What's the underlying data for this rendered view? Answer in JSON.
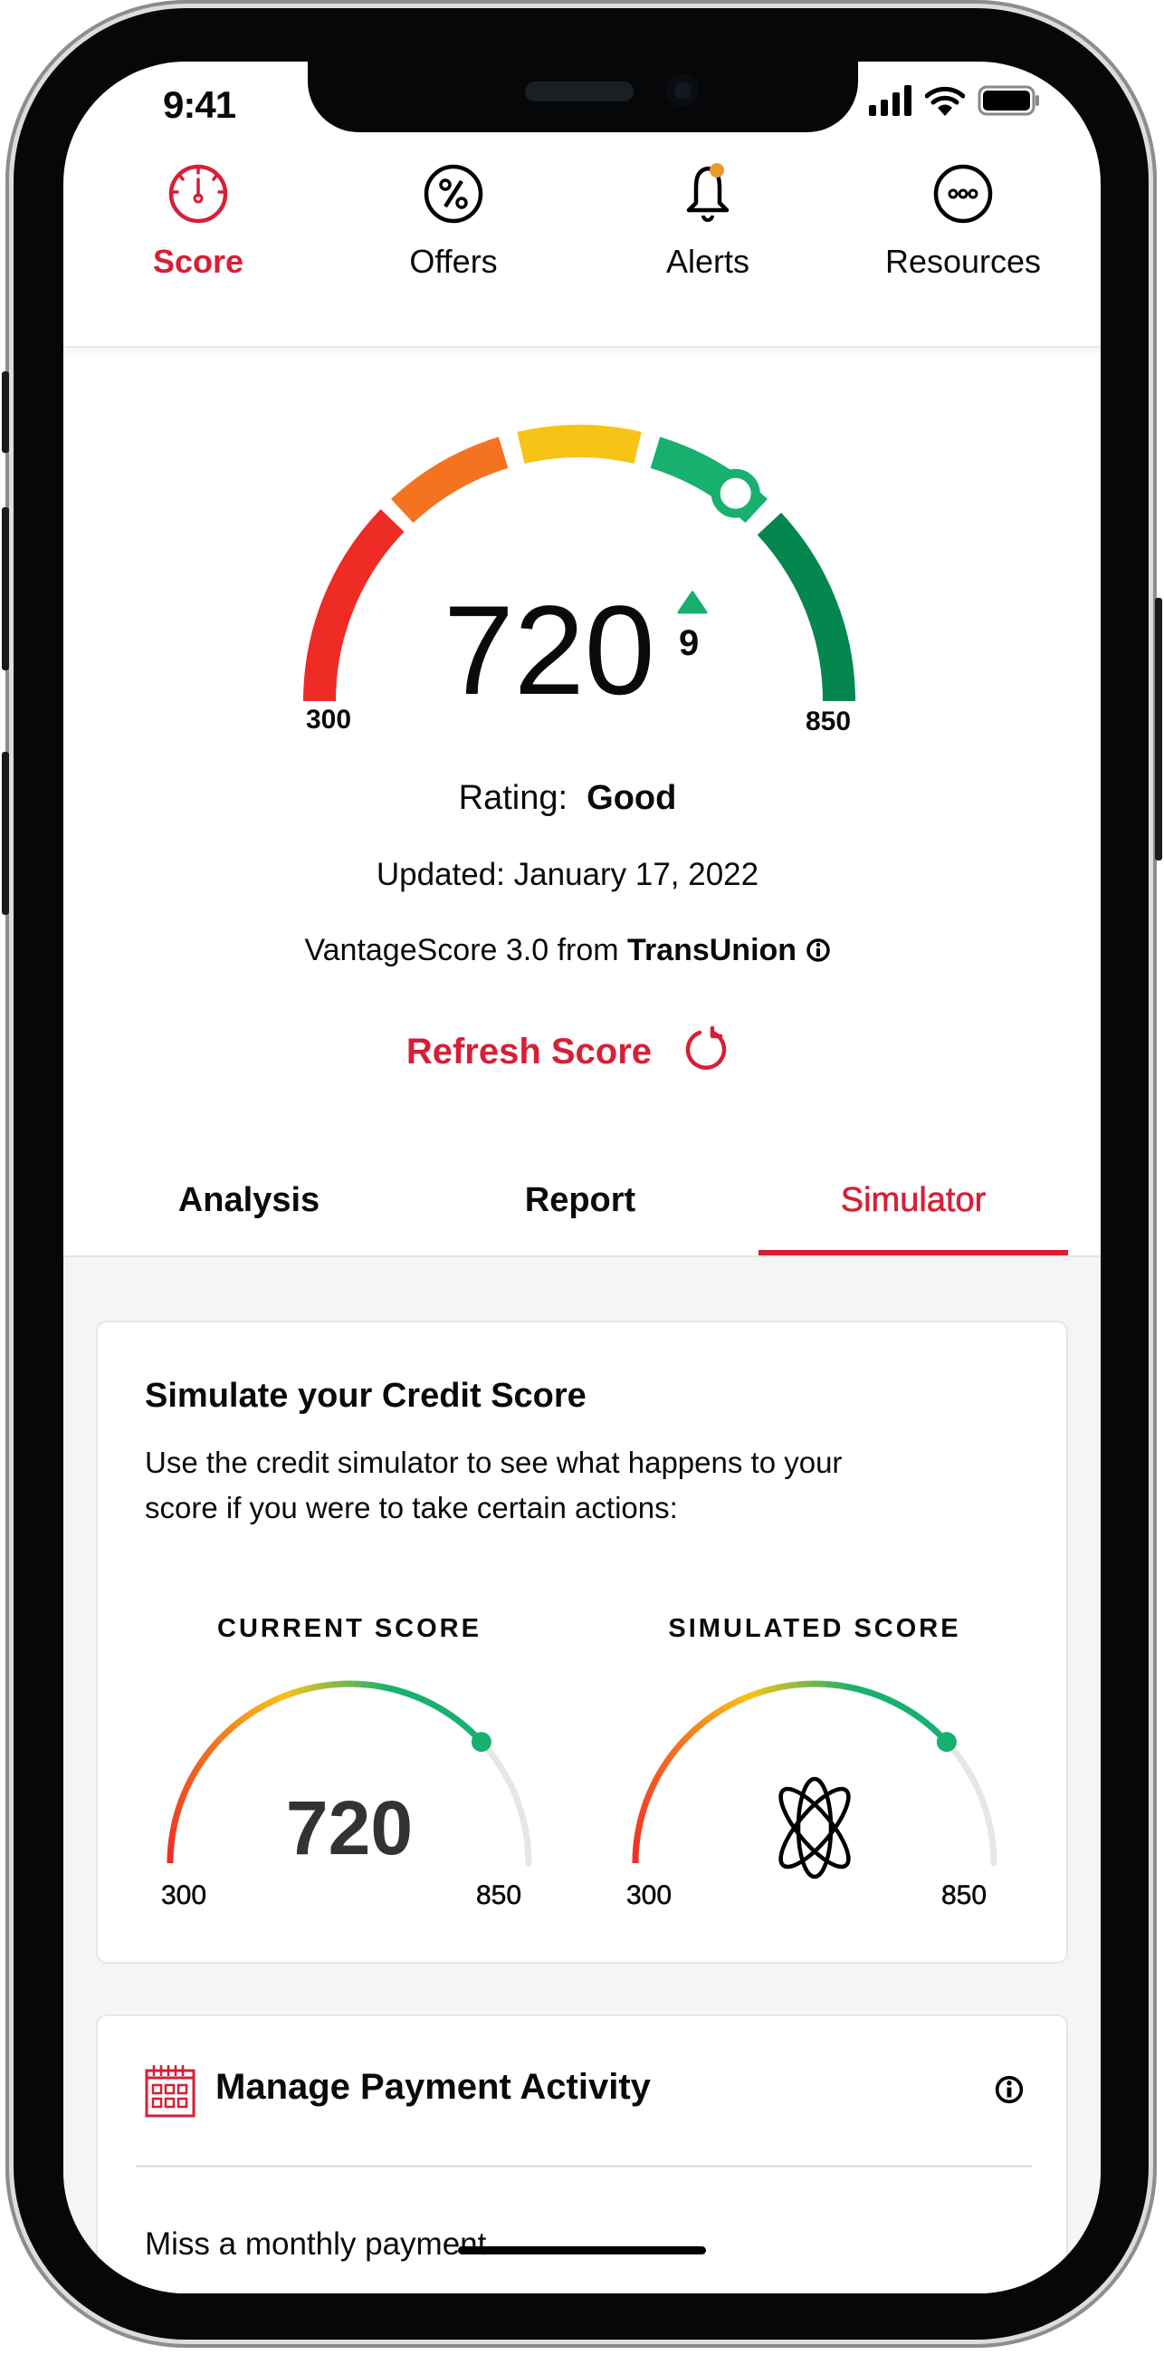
{
  "status_bar": {
    "time": "9:41"
  },
  "nav": {
    "items": [
      {
        "label": "Score",
        "icon": "speedometer-icon",
        "active": true
      },
      {
        "label": "Offers",
        "icon": "percent-icon",
        "active": false
      },
      {
        "label": "Alerts",
        "icon": "bell-icon",
        "active": false,
        "badge": true
      },
      {
        "label": "Resources",
        "icon": "more-icon",
        "active": false
      }
    ]
  },
  "score": {
    "value": "720",
    "change": "9",
    "min": "300",
    "max": "850",
    "rating_label": "Rating:",
    "rating_value": "Good",
    "updated": "Updated: January 17, 2022",
    "source_prefix": "VantageScore 3.0 from",
    "source_bureau": "TransUnion",
    "refresh_label": "Refresh Score"
  },
  "subtabs": [
    {
      "label": "Analysis",
      "active": false
    },
    {
      "label": "Report",
      "active": false
    },
    {
      "label": "Simulator",
      "active": true
    }
  ],
  "simulator_card": {
    "title": "Simulate your Credit Score",
    "description_line1": "Use the credit simulator to see what happens to your",
    "description_line2": "score if you were to take certain actions:",
    "current": {
      "label": "CURRENT SCORE",
      "value": "720",
      "min": "300",
      "max": "850"
    },
    "simulated": {
      "label": "SIMULATED SCORE",
      "value_icon": "atom-icon",
      "min": "300",
      "max": "850"
    }
  },
  "payment_card": {
    "title": "Manage Payment Activity",
    "item1": "Miss a monthly payment"
  },
  "colors": {
    "brand_red": "#d71f35",
    "gauge_red": "#ee2b25",
    "gauge_orange": "#f37321",
    "gauge_yellow": "#f8c317",
    "gauge_green": "#18b06e",
    "gauge_dark_green": "#04874f",
    "badge_orange": "#e89a2c"
  }
}
